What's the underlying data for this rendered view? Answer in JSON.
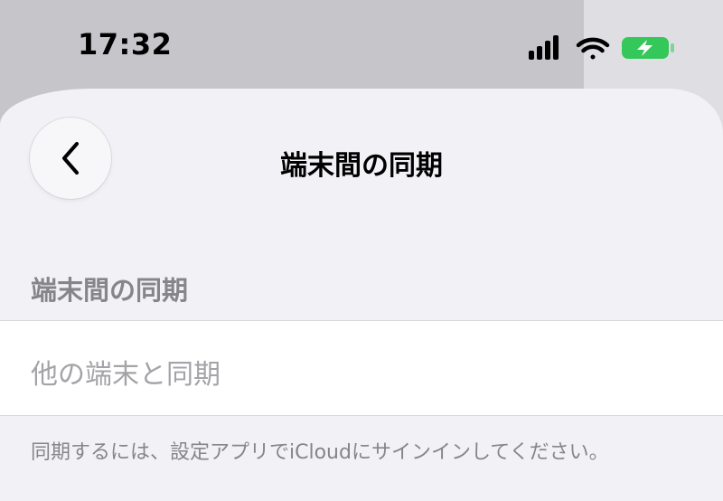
{
  "status_bar": {
    "time": "17:32",
    "icons": [
      "signal-icon",
      "wifi-icon",
      "battery-charging-icon"
    ],
    "battery_color": "#34c759"
  },
  "nav": {
    "back_icon": "chevron-left-icon",
    "title": "端末間の同期"
  },
  "section": {
    "header": "端末間の同期",
    "cell_label": "他の端末と同期",
    "footer": "同期するには、設定アプリでiCloudにサインインしてください。"
  }
}
